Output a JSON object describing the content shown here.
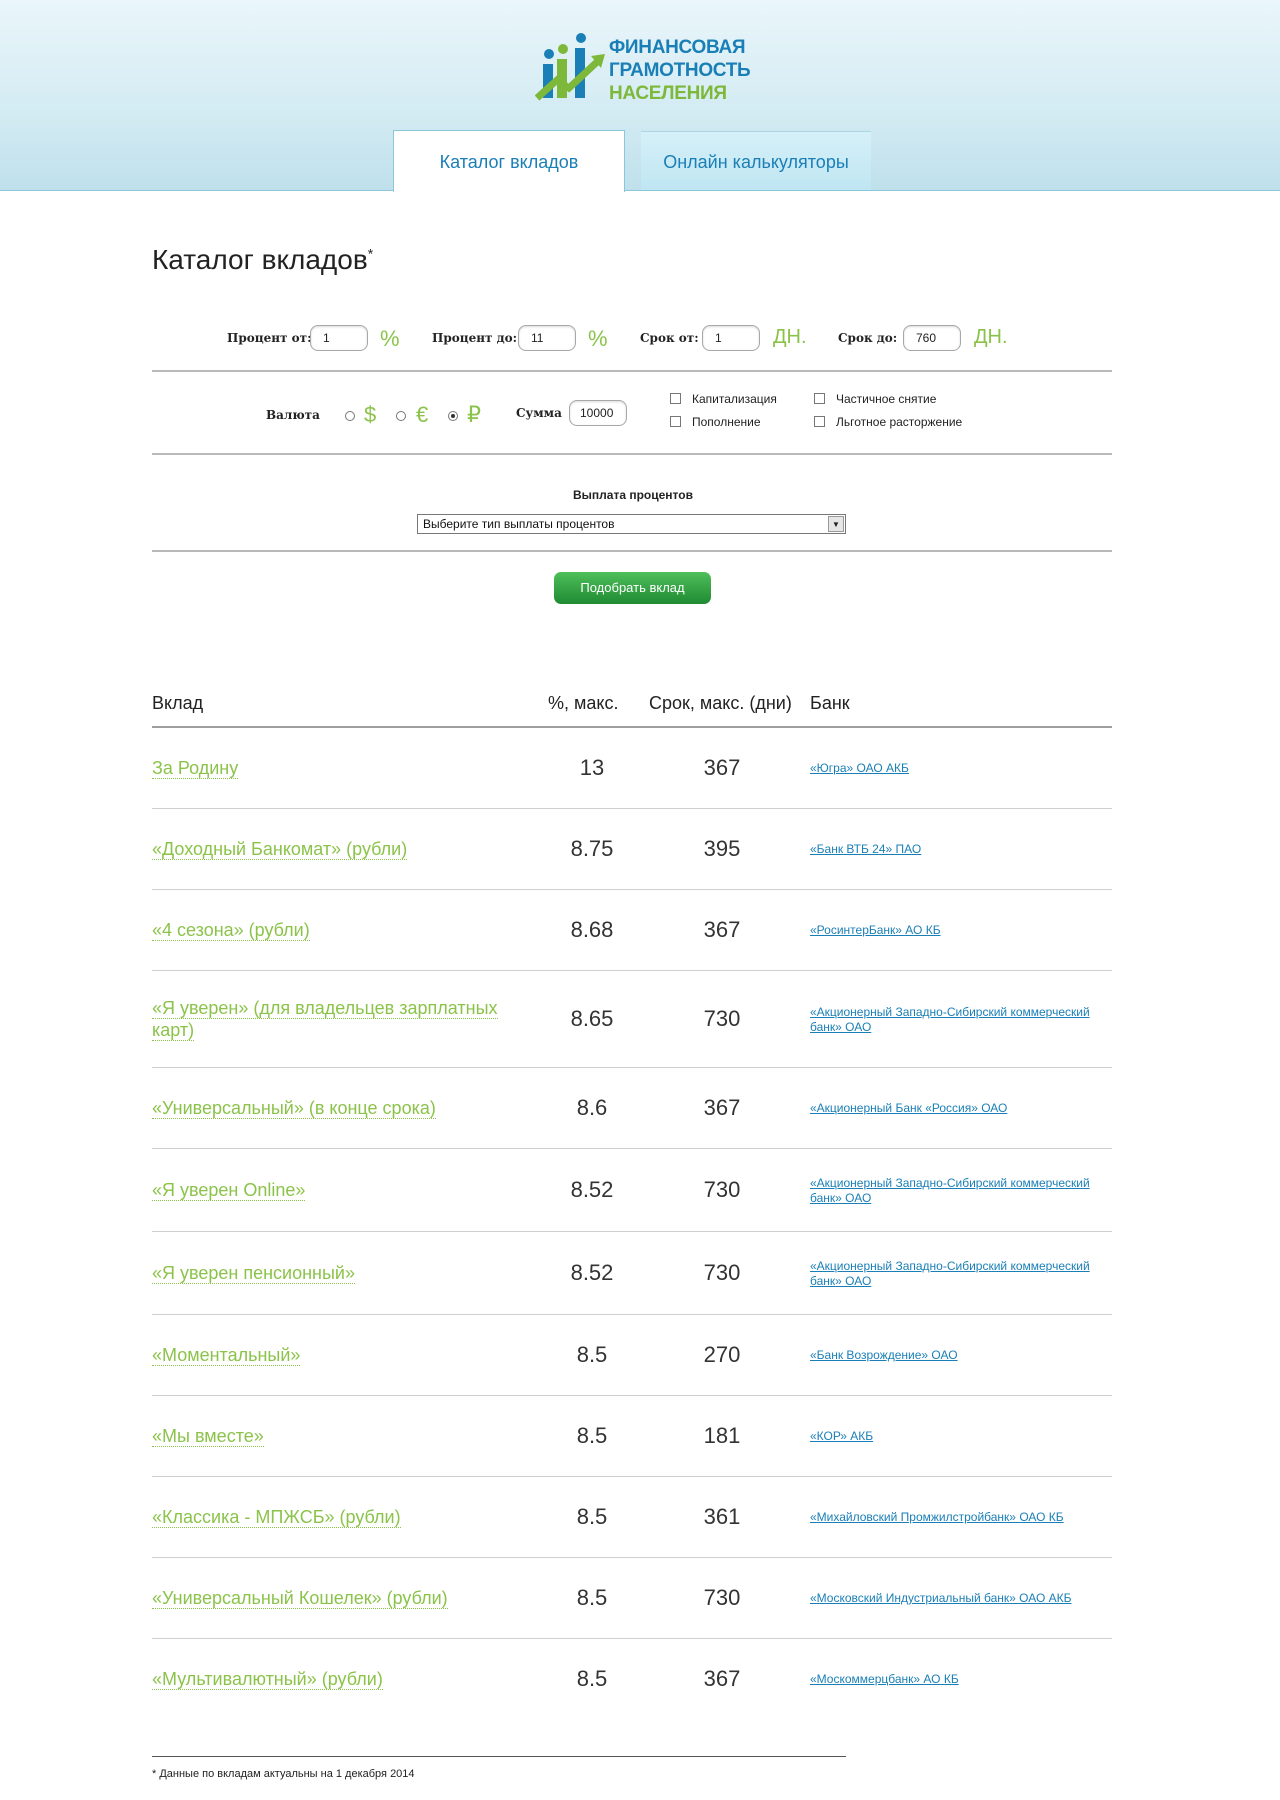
{
  "logo": {
    "line1": "ФИНАНСОВАЯ",
    "line2": "ГРАМОТНОСТЬ",
    "line3": "НАСЕЛЕНИЯ"
  },
  "tabs": [
    {
      "label": "Каталог вкладов",
      "active": true
    },
    {
      "label": "Онлайн калькуляторы",
      "active": false
    }
  ],
  "page_title": "Каталог вкладов",
  "page_title_mark": "*",
  "filters": {
    "percent_from_label": "Процент от:",
    "percent_from_value": "1",
    "percent_to_label": "Процент до:",
    "percent_to_value": "11",
    "percent_unit": "%",
    "term_from_label": "Срок от:",
    "term_from_value": "1",
    "term_to_label": "Срок до:",
    "term_to_value": "760",
    "term_unit": "ДН.",
    "currency_label": "Валюта",
    "currencies": [
      {
        "symbol": "$",
        "selected": false
      },
      {
        "symbol": "€",
        "selected": false
      },
      {
        "symbol": "₽",
        "selected": true
      }
    ],
    "sum_label": "Сумма",
    "sum_value": "10000",
    "checkboxes": [
      {
        "label": "Капитализация",
        "checked": false
      },
      {
        "label": "Пополнение",
        "checked": false
      },
      {
        "label": "Частичное снятие",
        "checked": false
      },
      {
        "label": "Льготное расторжение",
        "checked": false
      }
    ],
    "payout_label": "Выплата процентов",
    "payout_select": "Выберите тип выплаты процентов",
    "submit_label": "Подобрать вклад"
  },
  "table": {
    "headers": {
      "deposit": "Вклад",
      "percent": "%, макс.",
      "term": "Срок, макс. (дни)",
      "bank": "Банк"
    },
    "rows": [
      {
        "deposit": "За Родину",
        "percent": "13",
        "term": "367",
        "bank": "«Югра» ОАО АКБ"
      },
      {
        "deposit": "«Доходный Банкомат» (рубли)",
        "percent": "8.75",
        "term": "395",
        "bank": "«Банк ВТБ 24» ПАО"
      },
      {
        "deposit": "«4 сезона» (рубли)",
        "percent": "8.68",
        "term": "367",
        "bank": "«РосинтерБанк» АО КБ"
      },
      {
        "deposit": "«Я уверен» (для владельцев зарплатных карт)",
        "percent": "8.65",
        "term": "730",
        "bank": "«Акционерный Западно-Сибирский коммерческий банк» ОАО"
      },
      {
        "deposit": "«Универсальный» (в конце срока)",
        "percent": "8.6",
        "term": "367",
        "bank": "«Акционерный Банк «Россия» ОАО"
      },
      {
        "deposit": "«Я уверен Online»",
        "percent": "8.52",
        "term": "730",
        "bank": "«Акционерный Западно-Сибирский коммерческий банк» ОАО"
      },
      {
        "deposit": "«Я уверен пенсионный»",
        "percent": "8.52",
        "term": "730",
        "bank": "«Акционерный Западно-Сибирский коммерческий банк» ОАО"
      },
      {
        "deposit": "«Моментальный»",
        "percent": "8.5",
        "term": "270",
        "bank": "«Банк Возрождение» ОАО"
      },
      {
        "deposit": "«Мы вместе»",
        "percent": "8.5",
        "term": "181",
        "bank": "«КОР» АКБ"
      },
      {
        "deposit": "«Классика - МПЖСБ» (рубли)",
        "percent": "8.5",
        "term": "361",
        "bank": "«Михайловский Промжилстройбанк» ОАО КБ"
      },
      {
        "deposit": "«Универсальный Кошелек» (рубли)",
        "percent": "8.5",
        "term": "730",
        "bank": "«Московский Индустриальный банк» ОАО АКБ"
      },
      {
        "deposit": "«Мультивалютный» (рубли)",
        "percent": "8.5",
        "term": "367",
        "bank": "«Москоммерцбанк» АО КБ"
      }
    ]
  },
  "footnote": "* Данные по вкладам актуальны на 1 декабря 2014"
}
